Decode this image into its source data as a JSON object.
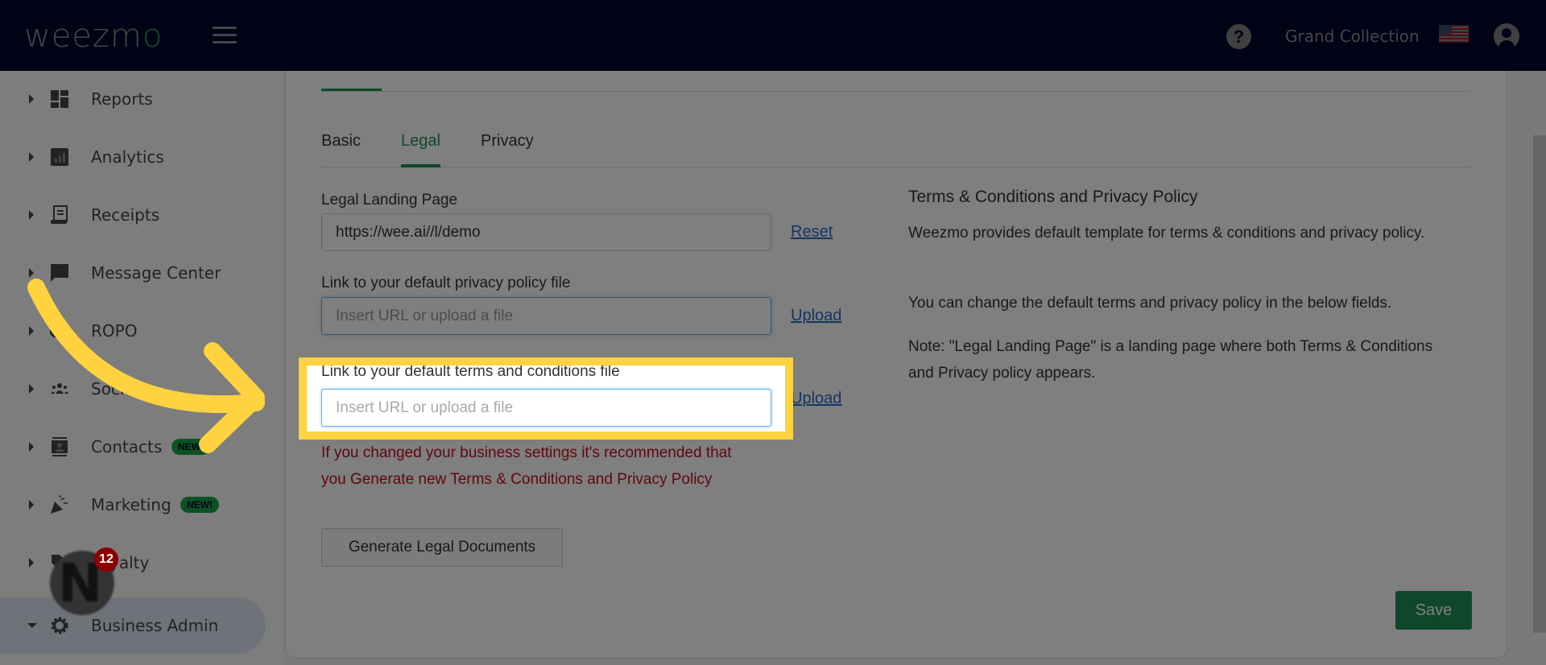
{
  "header": {
    "logo_text": "weezm",
    "logo_accent": "o",
    "account_name": "Grand Collection",
    "icons": [
      "menu-icon",
      "help-icon",
      "us-flag-icon",
      "user-account-icon"
    ]
  },
  "sidebar": {
    "items": [
      {
        "label": "Reports",
        "icon": "dashboard-icon",
        "expanded": false
      },
      {
        "label": "Analytics",
        "icon": "bar-chart-icon",
        "expanded": false
      },
      {
        "label": "Receipts",
        "icon": "receipt-icon",
        "expanded": false
      },
      {
        "label": "Message Center",
        "icon": "chat-icon",
        "expanded": false
      },
      {
        "label": "ROPO",
        "icon": "ropo-icon",
        "expanded": false
      },
      {
        "label": "Social",
        "icon": "people-icon",
        "expanded": false
      },
      {
        "label": "Contacts",
        "icon": "contact-card-icon",
        "badge": "NEW!",
        "expanded": false
      },
      {
        "label": "Marketing",
        "icon": "party-popper-icon",
        "badge": "NEW!",
        "expanded": false
      },
      {
        "label": "Loyalty",
        "icon": "loyalty-icon",
        "expanded": false
      },
      {
        "label": "Business Admin",
        "icon": "gear-icon",
        "expanded": true,
        "active": true
      }
    ]
  },
  "tabs": [
    {
      "label": "Basic",
      "active": false
    },
    {
      "label": "Legal",
      "active": true
    },
    {
      "label": "Privacy",
      "active": false
    }
  ],
  "form": {
    "landing_page": {
      "label": "Legal Landing Page",
      "value": "https://wee.ai//l/demo",
      "action": "Reset"
    },
    "privacy_file": {
      "label": "Link to your default privacy policy file",
      "placeholder": "Insert URL or upload a file",
      "value": "",
      "action": "Upload"
    },
    "terms_file": {
      "label": "Link to your default terms and conditions file",
      "placeholder": "Insert URL or upload a file",
      "value": "",
      "action": "Upload"
    },
    "warning": "If you changed your business settings it's recommended that you Generate new Terms & Conditions and Privacy Policy",
    "generate_button": "Generate Legal Documents"
  },
  "info": {
    "title": "Terms & Conditions and Privacy Policy",
    "paragraphs": [
      "Weezmo provides default template for terms & conditions and privacy policy.",
      "You can change the default terms and privacy policy in the below fields.",
      "Note: \"Legal Landing Page\" is a landing page where both Terms & Conditions and Privacy policy appears."
    ]
  },
  "save_button": "Save",
  "notification_widget": {
    "glyph": "N",
    "count": "12"
  },
  "colors": {
    "brand_green": "#1f8f57",
    "header_bg": "#00052a",
    "highlight": "#ffd240",
    "warning_red": "#c0101a",
    "link_blue": "#2a6bc0"
  }
}
